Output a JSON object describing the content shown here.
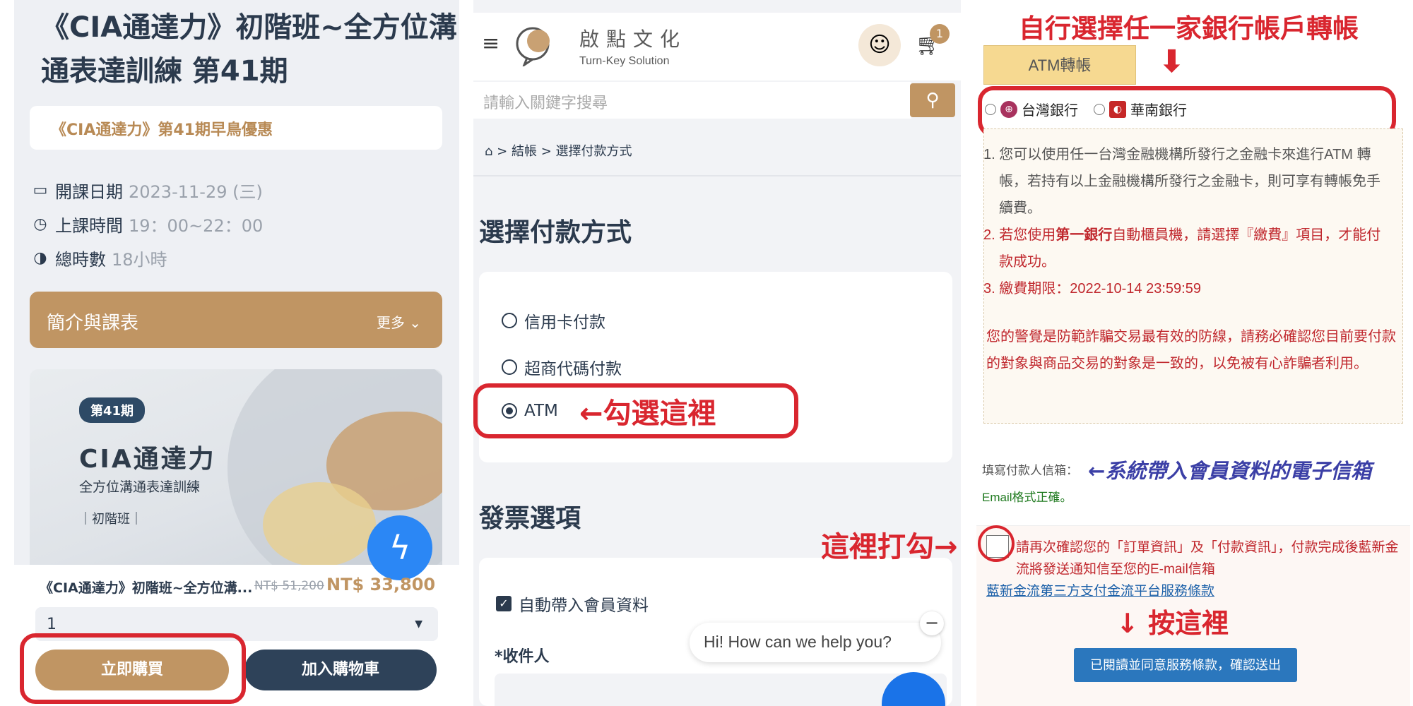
{
  "panel1": {
    "title": "《CIA通達力》初階班~全方位溝通表達訓練 第41期",
    "promo": "《CIA通達力》第41期早鳥優惠",
    "info": [
      {
        "label": "開課日期",
        "value": "2023-11-29 (三)",
        "icon": "calendar-icon"
      },
      {
        "label": "上課時間",
        "value": "19：00~22：00",
        "icon": "timer-icon"
      },
      {
        "label": "總時數",
        "value": "18小時",
        "icon": "clock-icon"
      }
    ],
    "intro": "簡介與課表",
    "more": "更多",
    "banner": {
      "badge": "第41期",
      "title": "CIA通達力",
      "subtitle": "全方位溝通表達訓練",
      "level": "初階班"
    },
    "product_name": "《CIA通達力》初階班~全方位溝...",
    "old_price": "NT$ 51,200",
    "new_price": "NT$ 33,800",
    "qty": "1",
    "buy_label": "立即購買",
    "cart_label": "加入購物車"
  },
  "panel2": {
    "brand": "啟點文化",
    "brand_sub": "Turn-Key Solution",
    "cart_count": "1",
    "search_placeholder": "請輸入關鍵字搜尋",
    "breadcrumb": [
      " > ",
      "結帳",
      " > ",
      "選擇付款方式"
    ],
    "h1": "選擇付款方式",
    "payment_options": [
      "信用卡付款",
      "超商代碼付款",
      "ATM"
    ],
    "selected": "ATM",
    "annotation": "←勾選這裡",
    "h2": "發票選項",
    "auto_fill": "自動帶入會員資料",
    "receiver": "*收件人",
    "chat": "Hi! How can we help you?"
  },
  "panel3": {
    "top_annotation": "自行選擇任一家銀行帳戶轉帳",
    "tab": "ATM轉帳",
    "banks": [
      "台灣銀行",
      "華南銀行"
    ],
    "notes": [
      "1. 您可以使用任一台灣金融機構所發行之金融卡來進行ATM 轉帳，若持有以上金融機構所發行之金融卡，則可享有轉帳免手續費。",
      {
        "pre": "2. 若您使用",
        "bold": "第一銀行",
        "post": "自動櫃員機，請選擇『繳費』項目，才能付款成功。"
      },
      "3. 繳費期限：2022-10-14 23:59:59"
    ],
    "warning": "您的警覺是防範詐騙交易最有效的防線，請務必確認您目前要付款的對象與商品交易的對象是一致的，以免被有心詐騙者利用。",
    "email_label": "填寫付款人信箱：",
    "email_annotation": "←系統帶入會員資料的電子信箱",
    "email_ok": "Email格式正確。",
    "check_annotation": "這裡打勾→",
    "confirm_text": "請再次確認您的「訂單資訊」及「付款資訊」，付款完成後藍新金流將發送通知信至您的E-mail信箱",
    "tos": "藍新金流第三方支付金流平台服務條款",
    "press_annotation": "↓ 按這裡",
    "submit": "已閱讀並同意服務條款，確認送出"
  },
  "colors": {
    "accent": "#c09563",
    "navy": "#2e4259",
    "red": "#d9262f",
    "blue": "#2b77bd"
  }
}
